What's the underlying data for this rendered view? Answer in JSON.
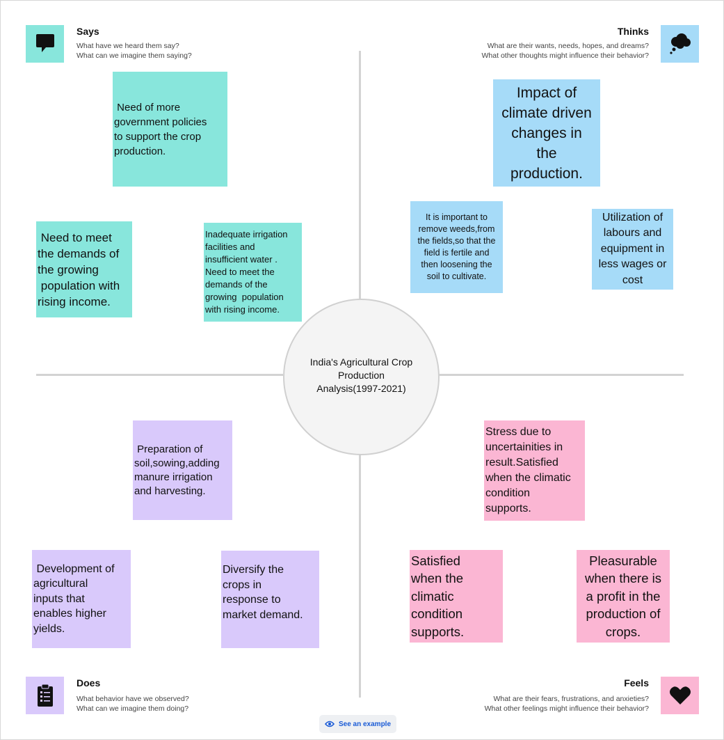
{
  "center": {
    "title": "India's Agricultural Crop\nProduction\nAnalysis(1997-2021)"
  },
  "quadrants": {
    "says": {
      "title": "Says",
      "subtitle_1": "What have we heard them say?",
      "subtitle_2": "What can we imagine them saying?",
      "icon": "speech-bubble-icon",
      "color": "#88e6dc"
    },
    "thinks": {
      "title": "Thinks",
      "subtitle_1": "What are their wants, needs, hopes, and dreams?",
      "subtitle_2": "What other thoughts might influence their behavior?",
      "icon": "thought-cloud-icon",
      "color": "#a6dbf8"
    },
    "does": {
      "title": "Does",
      "subtitle_1": "What behavior have we observed?",
      "subtitle_2": "What can we imagine them doing?",
      "icon": "clipboard-icon",
      "color": "#d9c9fb"
    },
    "feels": {
      "title": "Feels",
      "subtitle_1": "What are their fears, frustrations, and anxieties?",
      "subtitle_2": "What other feelings might influence their behavior?",
      "icon": "heart-icon",
      "color": "#fbb6d3"
    }
  },
  "notes": {
    "says_1": " Need of more\ngovernment policies\nto support the crop\nproduction.",
    "says_2": " Need to meet\nthe demands of\nthe growing\n population with\nrising income.",
    "says_3": "Inadequate irrigation\nfacilities and\ninsufficient water .\nNeed to meet the\ndemands of the\ngrowing  population\nwith rising income.",
    "thinks_1": "Impact of\nclimate driven\nchanges in\nthe\nproduction.",
    "thinks_2": "It is important to\nremove weeds,from\nthe fields,so that the\nfield is fertile and\nthen loosening the\nsoil to cultivate.",
    "thinks_3": "Utilization of\nlabours and\nequipment in\nless wages or\ncost",
    "does_1": " Preparation of\nsoil,sowing,adding\nmanure irrigation\nand harvesting.",
    "does_2": " Development of\nagricultural\ninputs that\nenables higher\nyields.",
    "does_3": "Diversify the\ncrops in\nresponse to\nmarket demand.",
    "feels_1": "Stress due to\nuncertainities in\nresult.Satisfied\nwhen the climatic\ncondition\nsupports.",
    "feels_2": "Satisfied\nwhen the\nclimatic\ncondition\nsupports.",
    "feels_3": "Pleasurable\nwhen there is\na profit in the\nproduction of\ncrops."
  },
  "footer": {
    "example_label": "See an example",
    "example_icon": "eye-icon"
  }
}
